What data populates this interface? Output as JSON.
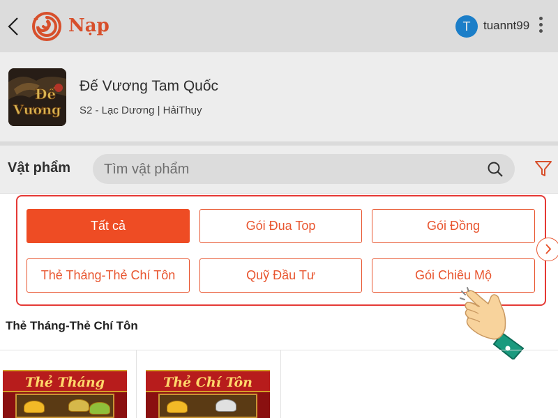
{
  "header": {
    "title": "Nạp",
    "avatar_letter": "T",
    "username": "tuannt99",
    "icons": {
      "back": "chevron-left-icon",
      "logo": "garena-swirl-logo",
      "menu": "more-vertical-icon"
    },
    "accent_color": "#e8552f"
  },
  "game": {
    "name": "Đế Vương Tam Quốc",
    "server": "S2 - Lạc Dương | HảiThụy",
    "thumbnail_text": [
      "Đế",
      "Vương"
    ]
  },
  "items": {
    "section_title": "Vật phẩm",
    "search_placeholder": "Tìm vật phẩm",
    "search_value": "",
    "icons": {
      "search": "search-icon",
      "filter": "filter-icon"
    }
  },
  "categories": [
    {
      "label": "Tất cả",
      "active": true
    },
    {
      "label": "Gói Đua Top",
      "active": false
    },
    {
      "label": "Gói Đồng",
      "active": false
    },
    {
      "label": "Thẻ Tháng-Thẻ Chí Tôn",
      "active": false
    },
    {
      "label": "Quỹ Đầu Tư",
      "active": false
    },
    {
      "label": "Gói Chiêu Mộ",
      "active": false
    }
  ],
  "product_section": {
    "heading": "Thẻ Tháng-Thẻ Chí Tôn",
    "cards": [
      {
        "banner_title": "Thẻ Tháng"
      },
      {
        "banner_title": "Thẻ Chí Tôn"
      }
    ]
  },
  "colors": {
    "brand": "#e8552f",
    "active_button": "#ee4c24",
    "highlight_border": "#e53935",
    "avatar": "#1e88d8"
  }
}
